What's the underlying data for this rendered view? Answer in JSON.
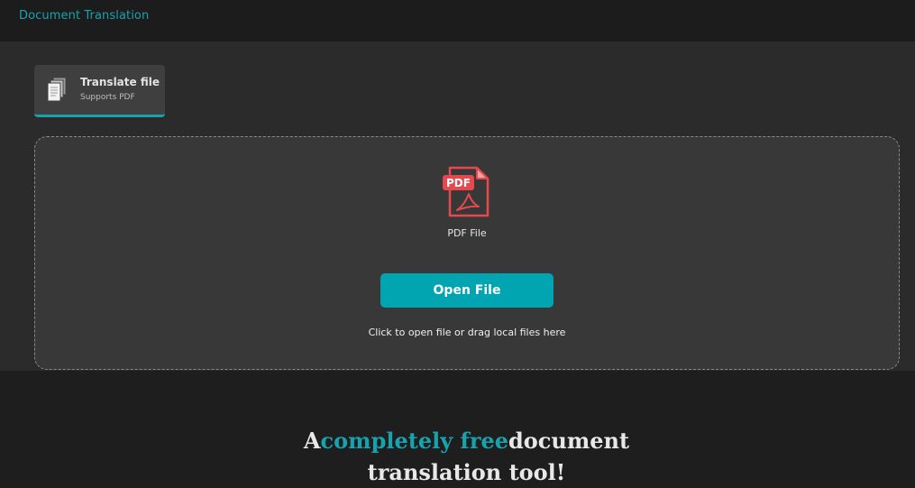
{
  "header": {
    "app_title": "Document Translation"
  },
  "mode_card": {
    "title": "Translate file",
    "subtitle": "Supports PDF",
    "icon": "documents-icon"
  },
  "dropzone": {
    "file_icon": "pdf-file-icon",
    "file_icon_text": "PDF",
    "file_type_label": "PDF File",
    "open_button_label": "Open File",
    "hint": "Click to open file or drag local files here"
  },
  "headline": {
    "part1": "A",
    "accent": "completely free",
    "part2": "document",
    "line2": "translation tool!"
  },
  "colors": {
    "accent": "#17a3ad",
    "button": "#00a5b1",
    "pdf_red": "#e5484d"
  }
}
